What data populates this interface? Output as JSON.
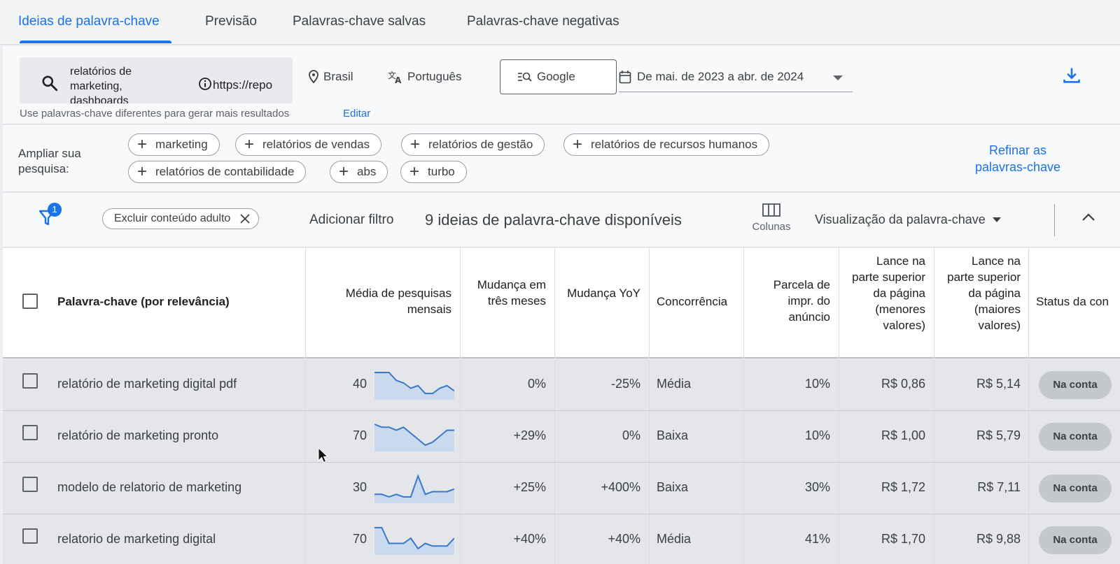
{
  "tabs": [
    {
      "label": "Ideias de palavra-chave",
      "active": true
    },
    {
      "label": "Previsão",
      "active": false
    },
    {
      "label": "Palavras-chave salvas",
      "active": false
    },
    {
      "label": "Palavras-chave negativas",
      "active": false
    }
  ],
  "search": {
    "keywords": "relatórios de marketing, dashboards",
    "url": "https://repo",
    "location": "Brasil",
    "language": "Português",
    "network": "Google",
    "date_range": "De mai. de 2023 a abr. de 2024",
    "hint": "Use palavras-chave diferentes para gerar mais resultados",
    "edit_label": "Editar"
  },
  "broaden": {
    "label": "Ampliar sua pesquisa:",
    "chips": [
      "marketing",
      "relatórios de vendas",
      "relatórios de gestão",
      "relatórios de recursos humanos",
      "relatórios de contabilidade",
      "abs",
      "turbo"
    ],
    "refine_label": "Refinar as palavras-chave"
  },
  "filterbar": {
    "filter_count": "1",
    "active_filter": "Excluir conteúdo adulto",
    "add_filter": "Adicionar filtro",
    "ideas_count": "9 ideias de palavra-chave disponíveis",
    "columns_label": "Colunas",
    "view_label": "Visualização da palavra-chave"
  },
  "table": {
    "headers": {
      "keyword": "Palavra-chave (por relevância)",
      "avg": "Média de pesquisas mensais",
      "three_month": "Mudança em três meses",
      "yoy": "Mudança YoY",
      "competition": "Concorrência",
      "impr_share": "Parcela de impr. do anúncio",
      "bid_low": "Lance na parte superior da página (menores valores)",
      "bid_high": "Lance na parte superior da página (maiores valores)",
      "status": "Status da con"
    },
    "rows": [
      {
        "keyword": "relatório de marketing digital pdf",
        "avg": "40",
        "three_month": "0%",
        "yoy": "-25%",
        "competition": "Média",
        "impr_share": "10%",
        "bid_low": "R$ 0,86",
        "bid_high": "R$ 5,14",
        "status": "Na conta",
        "trend": [
          9,
          9,
          9,
          6,
          5,
          3,
          4,
          1,
          1,
          3,
          4,
          2
        ]
      },
      {
        "keyword": "relatório de marketing pronto",
        "avg": "70",
        "three_month": "+29%",
        "yoy": "0%",
        "competition": "Baixa",
        "impr_share": "10%",
        "bid_low": "R$ 1,00",
        "bid_high": "R$ 5,79",
        "status": "Na conta",
        "trend": [
          9,
          8,
          8,
          7,
          8,
          6,
          4,
          2,
          3,
          5,
          7,
          7
        ]
      },
      {
        "keyword": "modelo de relatorio de marketing",
        "avg": "30",
        "three_month": "+25%",
        "yoy": "+400%",
        "competition": "Baixa",
        "impr_share": "30%",
        "bid_low": "R$ 1,72",
        "bid_high": "R$ 7,11",
        "status": "Na conta",
        "trend": [
          2,
          2,
          1,
          2,
          1,
          1,
          9,
          2,
          3,
          3,
          3,
          4
        ]
      },
      {
        "keyword": "relatorio de marketing digital",
        "avg": "70",
        "three_month": "+40%",
        "yoy": "+40%",
        "competition": "Média",
        "impr_share": "41%",
        "bid_low": "R$ 1,70",
        "bid_high": "R$ 9,88",
        "status": "Na conta",
        "trend": [
          9,
          9,
          3,
          3,
          3,
          5,
          1,
          3,
          2,
          2,
          2,
          5
        ]
      }
    ]
  },
  "colors": {
    "accent": "#1a73e8",
    "spark_line": "#3b78c9",
    "spark_fill": "#c9d9ee"
  }
}
